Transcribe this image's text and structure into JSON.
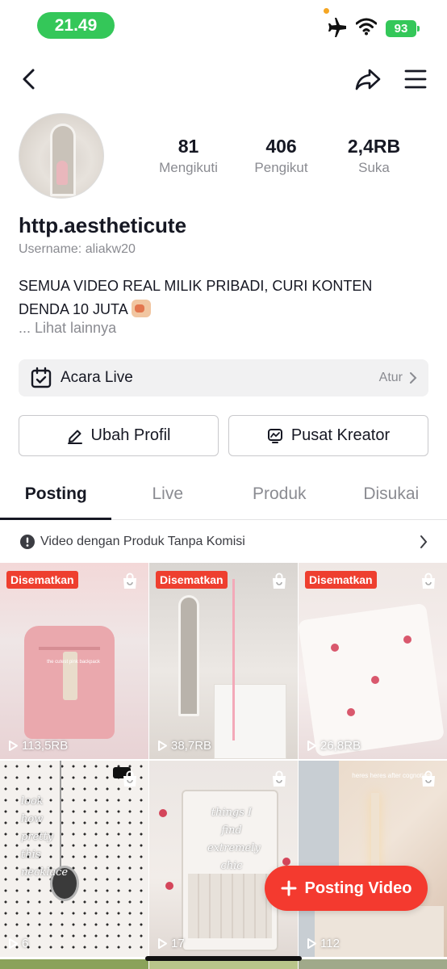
{
  "status_bar": {
    "time": "21.49",
    "battery": "93"
  },
  "profile": {
    "display_name": "http.aestheticute",
    "username_line": "Username: aliakw20",
    "bio_line1": "SEMUA VIDEO REAL MILIK PRIBADI, CURI KONTEN",
    "bio_line2": "DENDA 10 JUTA",
    "see_more": "... Lihat lainnya",
    "stats": [
      {
        "value": "81",
        "label": "Mengikuti"
      },
      {
        "value": "406",
        "label": "Pengikut"
      },
      {
        "value": "2,4RB",
        "label": "Suka"
      }
    ]
  },
  "live_event": {
    "label": "Acara Live",
    "action": "Atur"
  },
  "buttons": {
    "edit_profile": "Ubah Profil",
    "creator_center": "Pusat Kreator"
  },
  "tabs": [
    "Posting",
    "Live",
    "Produk",
    "Disukai"
  ],
  "notice": "Video dengan Produk Tanpa Komisi",
  "videos": [
    {
      "pinned": "Disematkan",
      "views": "113,5RB",
      "caption": "the cutest pink backpack"
    },
    {
      "pinned": "Disematkan",
      "views": "38,7RB",
      "caption": ""
    },
    {
      "pinned": "Disematkan",
      "views": "26,8RB",
      "caption": ""
    },
    {
      "views": "6",
      "caption": "look how pretty this necklace"
    },
    {
      "views": "17",
      "caption": "things I find extremely chic"
    },
    {
      "views": "112",
      "caption": "heres heres after cognotion"
    }
  ],
  "fab": {
    "label": "Posting Video"
  },
  "colors": {
    "accent": "#f43a2f",
    "status_green": "#34c759"
  }
}
